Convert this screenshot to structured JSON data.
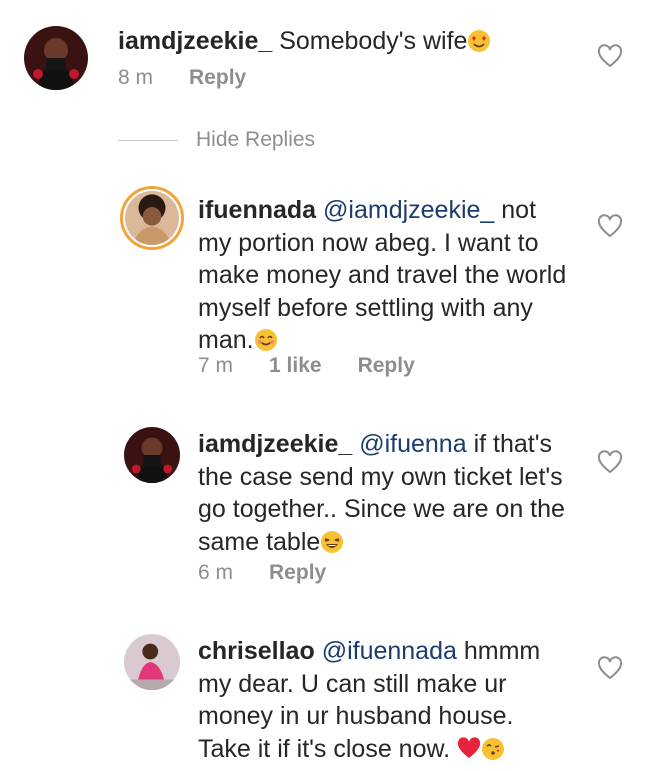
{
  "comments": [
    {
      "username": "iamdjzeekie_",
      "mention": "",
      "text": "Somebody's wife",
      "emoji": "heart-eyes-emoji",
      "time": "8 m",
      "likes": "",
      "reply_label": "Reply"
    },
    {
      "username": "ifuennada",
      "mention": "@iamdjzeekie_",
      "text": "not\nmy portion now abeg. I want to\nmake money and travel the world\nmyself before settling with any\nman.",
      "emoji": "smiling-emoji",
      "time": "7 m",
      "likes": "1 like",
      "reply_label": "Reply"
    },
    {
      "username": "iamdjzeekie_",
      "mention": "@ifuenna",
      "text": "if that's\nthe case send my own ticket let's\ngo together.. Since we are on the\nsame table",
      "emoji": "laughing-emoji",
      "time": "6 m",
      "likes": "",
      "reply_label": "Reply"
    },
    {
      "username": "chrisellao",
      "mention": "@ifuennada",
      "text": "hmmm\nmy dear. U can still make ur\nmoney in ur husband house.\nTake it if it's close now.",
      "emoji": "red-heart-and-kiss-emoji",
      "time": "",
      "likes": "",
      "reply_label": ""
    }
  ],
  "hide_replies_label": "Hide Replies",
  "colors": {
    "text": "#262626",
    "meta": "#8e8e8e",
    "mention": "#1a3c6e",
    "heart_outline": "#8e8e8e"
  }
}
